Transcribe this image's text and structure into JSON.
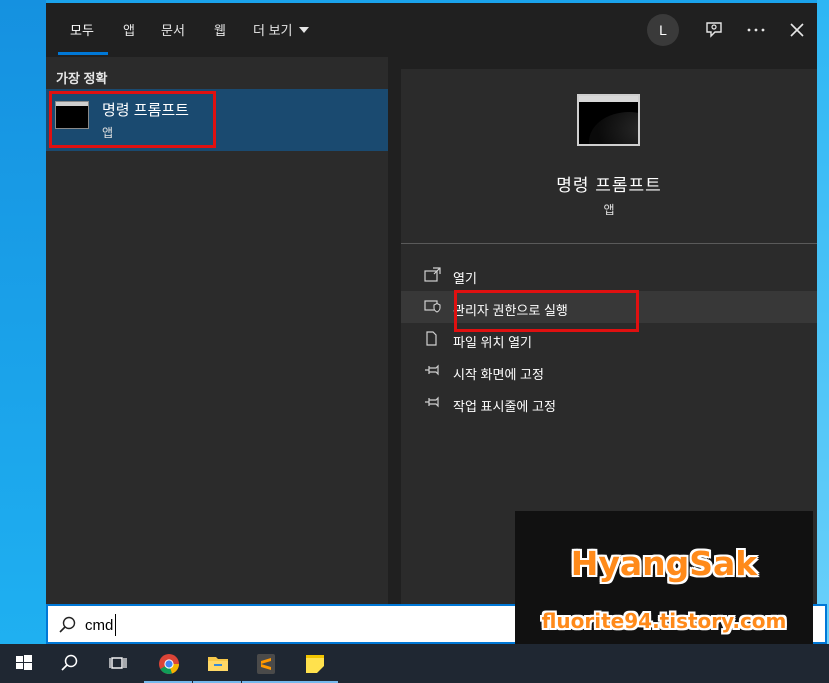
{
  "tabs": [
    {
      "label": "모두"
    },
    {
      "label": "앱"
    },
    {
      "label": "문서"
    },
    {
      "label": "웹"
    },
    {
      "label": "더 보기"
    }
  ],
  "header": {
    "avatar_initial": "L"
  },
  "left_pane": {
    "section_title": "가장 정확",
    "best_match": {
      "title": "명령 프롬프트",
      "subtitle": "앱"
    }
  },
  "right_pane": {
    "title": "명령 프롬프트",
    "subtitle": "앱",
    "actions": [
      {
        "label": "열기",
        "icon": "open-icon"
      },
      {
        "label": "관리자 권한으로 실행",
        "icon": "shield-icon"
      },
      {
        "label": "파일 위치 열기",
        "icon": "file-icon"
      },
      {
        "label": "시작 화면에 고정",
        "icon": "pin-icon"
      },
      {
        "label": "작업 표시줄에 고정",
        "icon": "pin-icon"
      }
    ]
  },
  "search": {
    "value": "cmd"
  },
  "watermark": {
    "title": "HyangSak",
    "url": "fluorite94.tistory.com"
  },
  "colors": {
    "accent": "#0078d7",
    "highlight": "#e01010",
    "selected": "#1a4a70",
    "watermark": "#ff8a1a"
  }
}
